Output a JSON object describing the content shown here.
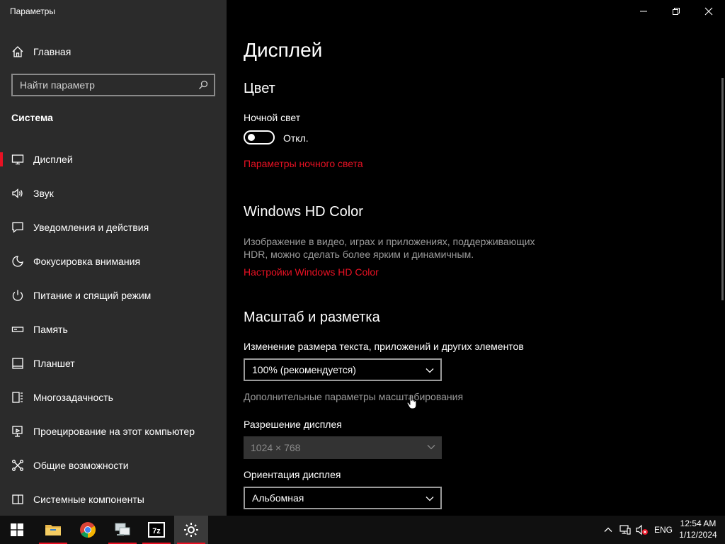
{
  "window": {
    "title": "Параметры",
    "controls": [
      "minimize",
      "maximize",
      "close"
    ]
  },
  "sidebar": {
    "home_label": "Главная",
    "search_placeholder": "Найти параметр",
    "section_title": "Система",
    "items": [
      {
        "label": "Дисплей",
        "icon": "display-icon",
        "active": true
      },
      {
        "label": "Звук",
        "icon": "speaker-icon"
      },
      {
        "label": "Уведомления и действия",
        "icon": "notifications-icon"
      },
      {
        "label": "Фокусировка внимания",
        "icon": "moon-icon"
      },
      {
        "label": "Питание и спящий режим",
        "icon": "power-icon"
      },
      {
        "label": "Память",
        "icon": "storage-icon"
      },
      {
        "label": "Планшет",
        "icon": "tablet-icon"
      },
      {
        "label": "Многозадачность",
        "icon": "multitasking-icon"
      },
      {
        "label": "Проецирование на этот компьютер",
        "icon": "projecting-icon"
      },
      {
        "label": "Общие возможности",
        "icon": "shared-experiences-icon"
      },
      {
        "label": "Системные компоненты",
        "icon": "system-components-icon"
      }
    ]
  },
  "main": {
    "title": "Дисплей",
    "color": {
      "heading": "Цвет",
      "night_light_label": "Ночной свет",
      "night_light_state": "Откл.",
      "night_light_on": false,
      "night_light_link": "Параметры ночного света"
    },
    "hdr": {
      "heading": "Windows HD Color",
      "description_line1": "Изображение в видео, играх и приложениях, поддерживающих",
      "description_line2": "HDR, можно сделать более ярким и динамичным.",
      "link": "Настройки Windows HD Color"
    },
    "scale": {
      "heading": "Масштаб и разметка",
      "size_label": "Изменение размера текста, приложений и других элементов",
      "size_value": "100% (рекомендуется)",
      "advanced_link": "Дополнительные параметры масштабирования",
      "resolution_label": "Разрешение дисплея",
      "resolution_value": "1024 × 768",
      "orientation_label": "Ориентация дисплея",
      "orientation_value": "Альбомная"
    }
  },
  "taskbar": {
    "apps": [
      "start-icon",
      "file-explorer-icon",
      "chrome-icon",
      "network-app-icon",
      "7zip-icon",
      "settings-gear-icon"
    ],
    "active_app": "settings-gear-icon",
    "tray_icons": [
      "chevron-up-icon",
      "network-icon",
      "volume-muted-icon"
    ],
    "language": "ENG",
    "time": "12:54 AM",
    "date": "1/12/2024"
  },
  "colors": {
    "accent": "#e81123",
    "sidebar_bg": "#2b2b2b",
    "main_bg": "#000000",
    "taskbar_bg": "#101010"
  }
}
